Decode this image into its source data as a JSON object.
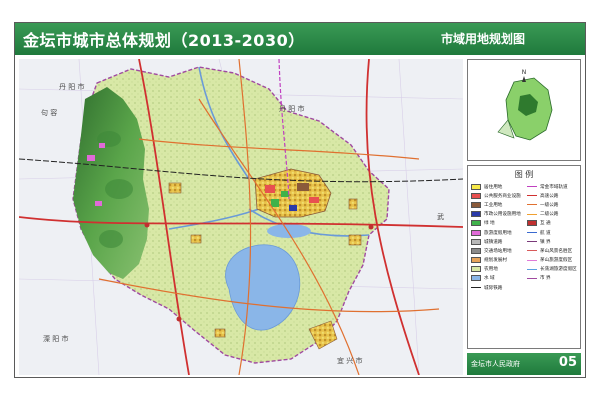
{
  "header": {
    "title": "金坛市城市总体规划（2013-2030）",
    "subtitle": "市域用地规划图"
  },
  "map": {
    "places": [
      "丹 阳 市",
      "句 容",
      "溧 阳 市",
      "宜 兴 市",
      "武"
    ],
    "lake_label": "长荡湖",
    "colors": {
      "hills": "#3f8a3a",
      "water": "#8ab6e8",
      "urban": "#e9c34a",
      "farmland": "#d8e8a6",
      "village": "#c6dc98"
    }
  },
  "inset": {
    "north_label": "N"
  },
  "legend": {
    "title": "图  例",
    "left": [
      {
        "label": "居住用地",
        "color": "#f7e948",
        "kind": "swatch"
      },
      {
        "label": "公共服务商业设施",
        "color": "#e85050",
        "kind": "swatch"
      },
      {
        "label": "工业用地",
        "color": "#8a5a3a",
        "kind": "swatch"
      },
      {
        "label": "市政公用设施用地",
        "color": "#2a3aa8",
        "kind": "swatch"
      },
      {
        "label": "绿 地",
        "color": "#3fb24a",
        "kind": "swatch"
      },
      {
        "label": "旅游度假用地",
        "color": "#e06ad8",
        "kind": "swatch"
      },
      {
        "label": "城镇道路",
        "color": "#b8b8b8",
        "kind": "swatch"
      },
      {
        "label": "交通场站用地",
        "color": "#8a8a8a",
        "kind": "swatch"
      },
      {
        "label": "规划发展村",
        "color": "#e6a35a",
        "kind": "swatch"
      },
      {
        "label": "农用地",
        "color": "#d8e8a6",
        "kind": "swatch"
      },
      {
        "label": "水 域",
        "color": "#8ab6e8",
        "kind": "swatch"
      },
      {
        "label": "城际铁路",
        "color": "#222222",
        "kind": "line"
      }
    ],
    "right": [
      {
        "label": "常金市域轨道",
        "color": "#c040c0",
        "kind": "line"
      },
      {
        "label": "高速公路",
        "color": "#d03030",
        "kind": "line"
      },
      {
        "label": "一级公路",
        "color": "#e07030",
        "kind": "line"
      },
      {
        "label": "二级公路",
        "color": "#f0a030",
        "kind": "line"
      },
      {
        "label": "互 通",
        "color": "#c03030",
        "kind": "swatch"
      },
      {
        "label": "航 道",
        "color": "#3a6ad0",
        "kind": "line"
      },
      {
        "label": "镇 界",
        "color": "#7a3a7a",
        "kind": "line"
      },
      {
        "label": "茅山风景名胜区",
        "color": "#d85a5a",
        "kind": "line"
      },
      {
        "label": "茅山旅游度假区",
        "color": "#e07ad8",
        "kind": "line"
      },
      {
        "label": "长荡湖旅游度假区",
        "color": "#5aa0e0",
        "kind": "line"
      },
      {
        "label": "市 界",
        "color": "#a04aa0",
        "kind": "line"
      }
    ]
  },
  "footer": {
    "government": "金坛市人民政府",
    "sheet_number": "05"
  }
}
